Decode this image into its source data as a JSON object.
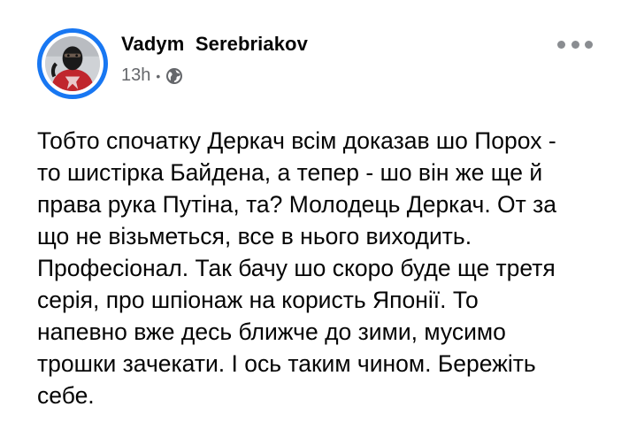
{
  "post": {
    "author": {
      "name": "Vadym  Serebriakov",
      "avatar_icon": "profile-photo"
    },
    "meta": {
      "time": "13h",
      "separator": "•",
      "audience_icon": "globe-icon"
    },
    "more_icon": "more-options-icon",
    "text_lines": [
      "Тобто спочатку Деркач всім доказав шо Порох -",
      "то шистірка Байдена, а тепер - шо він же ще й",
      "права рука Путіна, та? Молодець Деркач. От за",
      "що не візьметься, все в нього виходить.",
      "Професіонал. Так бачу шо скоро буде ще третя",
      "серія, про шпіонаж на користь Японії. То",
      "напевно вже десь ближче до зими, мусимо",
      "трошки зачекати. І ось таким чином. Бережіть",
      "себе."
    ]
  },
  "colors": {
    "story_ring": "#1877f2",
    "secondary_text": "#65676b",
    "primary_text": "#050505"
  }
}
